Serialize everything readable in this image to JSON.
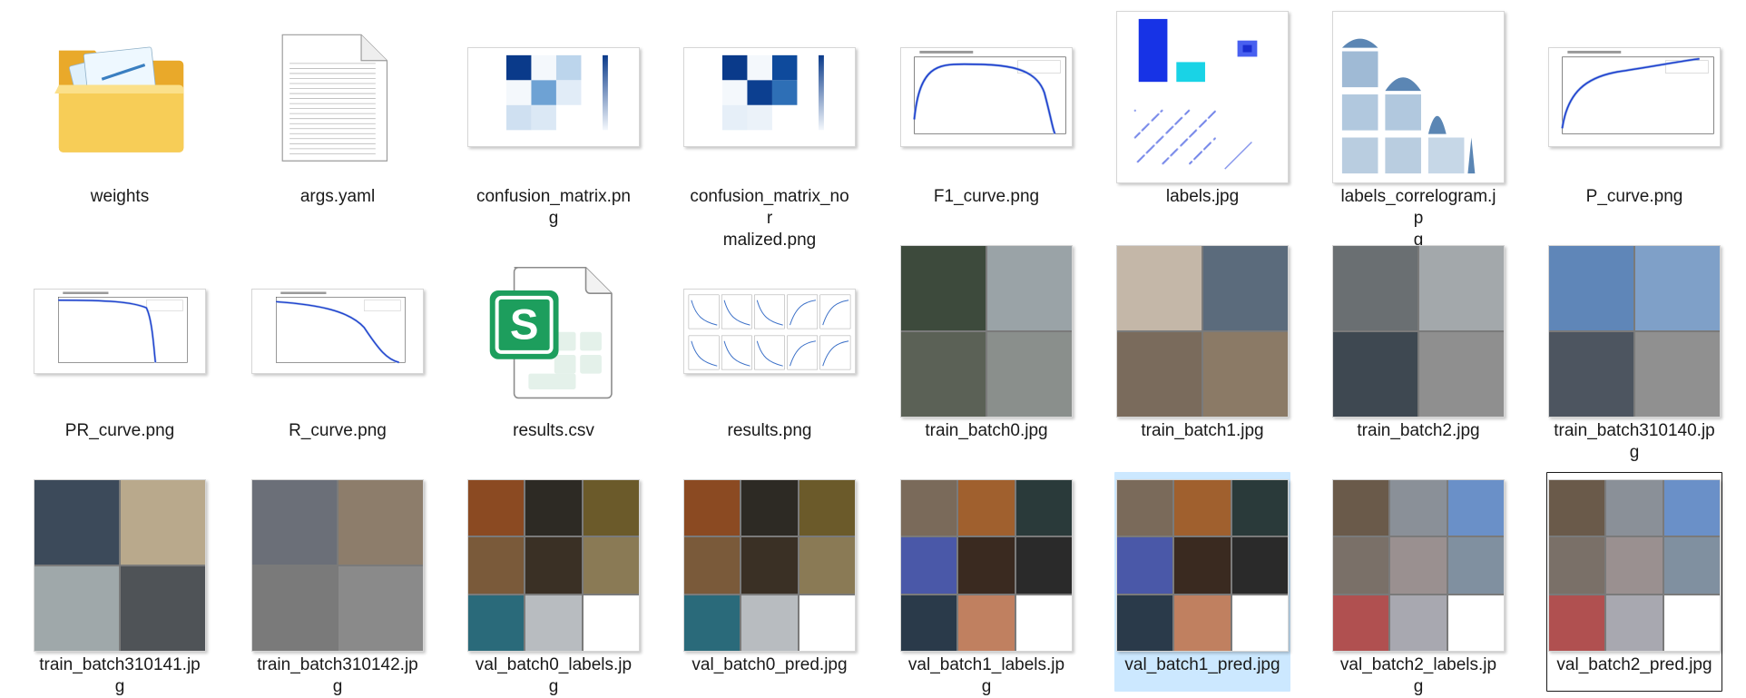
{
  "colors": {
    "selection": "#cce8ff",
    "focus_border": "#1a1a1a",
    "folder": "#f3c34b",
    "sheet_green": "#1d9e5d",
    "chart_blue": "#1f3fcf"
  },
  "files": [
    {
      "name": "weights",
      "label": "weights",
      "kind": "folder",
      "icon": "folder-icon"
    },
    {
      "name": "args-yaml",
      "label": "args.yaml",
      "kind": "text-document",
      "icon": "text-document-icon"
    },
    {
      "name": "confusion-matrix",
      "label": "confusion_matrix.png",
      "kind": "image"
    },
    {
      "name": "confusion-matrix-normalized",
      "label": "confusion_matrix_nor\nmalized.png",
      "kind": "image"
    },
    {
      "name": "f1-curve",
      "label": "F1_curve.png",
      "kind": "image"
    },
    {
      "name": "labels",
      "label": "labels.jpg",
      "kind": "image"
    },
    {
      "name": "labels-correlogram",
      "label": "labels_correlogram.jp\ng",
      "kind": "image"
    },
    {
      "name": "p-curve",
      "label": "P_curve.png",
      "kind": "image"
    },
    {
      "name": "pr-curve",
      "label": "PR_curve.png",
      "kind": "image"
    },
    {
      "name": "r-curve",
      "label": "R_curve.png",
      "kind": "image"
    },
    {
      "name": "results-csv",
      "label": "results.csv",
      "kind": "spreadsheet",
      "icon": "spreadsheet-icon",
      "icon_letter": "S"
    },
    {
      "name": "results-png",
      "label": "results.png",
      "kind": "image"
    },
    {
      "name": "train-batch0",
      "label": "train_batch0.jpg",
      "kind": "image"
    },
    {
      "name": "train-batch1",
      "label": "train_batch1.jpg",
      "kind": "image"
    },
    {
      "name": "train-batch2",
      "label": "train_batch2.jpg",
      "kind": "image"
    },
    {
      "name": "train-batch310140",
      "label": "train_batch310140.jp\ng",
      "kind": "image"
    },
    {
      "name": "train-batch310141",
      "label": "train_batch310141.jp\ng",
      "kind": "image"
    },
    {
      "name": "train-batch310142",
      "label": "train_batch310142.jp\ng",
      "kind": "image"
    },
    {
      "name": "val-batch0-labels",
      "label": "val_batch0_labels.jpg",
      "kind": "image"
    },
    {
      "name": "val-batch0-pred",
      "label": "val_batch0_pred.jpg",
      "kind": "image"
    },
    {
      "name": "val-batch1-labels",
      "label": "val_batch1_labels.jpg",
      "kind": "image"
    },
    {
      "name": "val-batch1-pred",
      "label": "val_batch1_pred.jpg",
      "kind": "image",
      "selected": true
    },
    {
      "name": "val-batch2-labels",
      "label": "val_batch2_labels.jpg",
      "kind": "image"
    },
    {
      "name": "val-batch2-pred",
      "label": "val_batch2_pred.jpg",
      "kind": "image",
      "focused": true
    }
  ]
}
